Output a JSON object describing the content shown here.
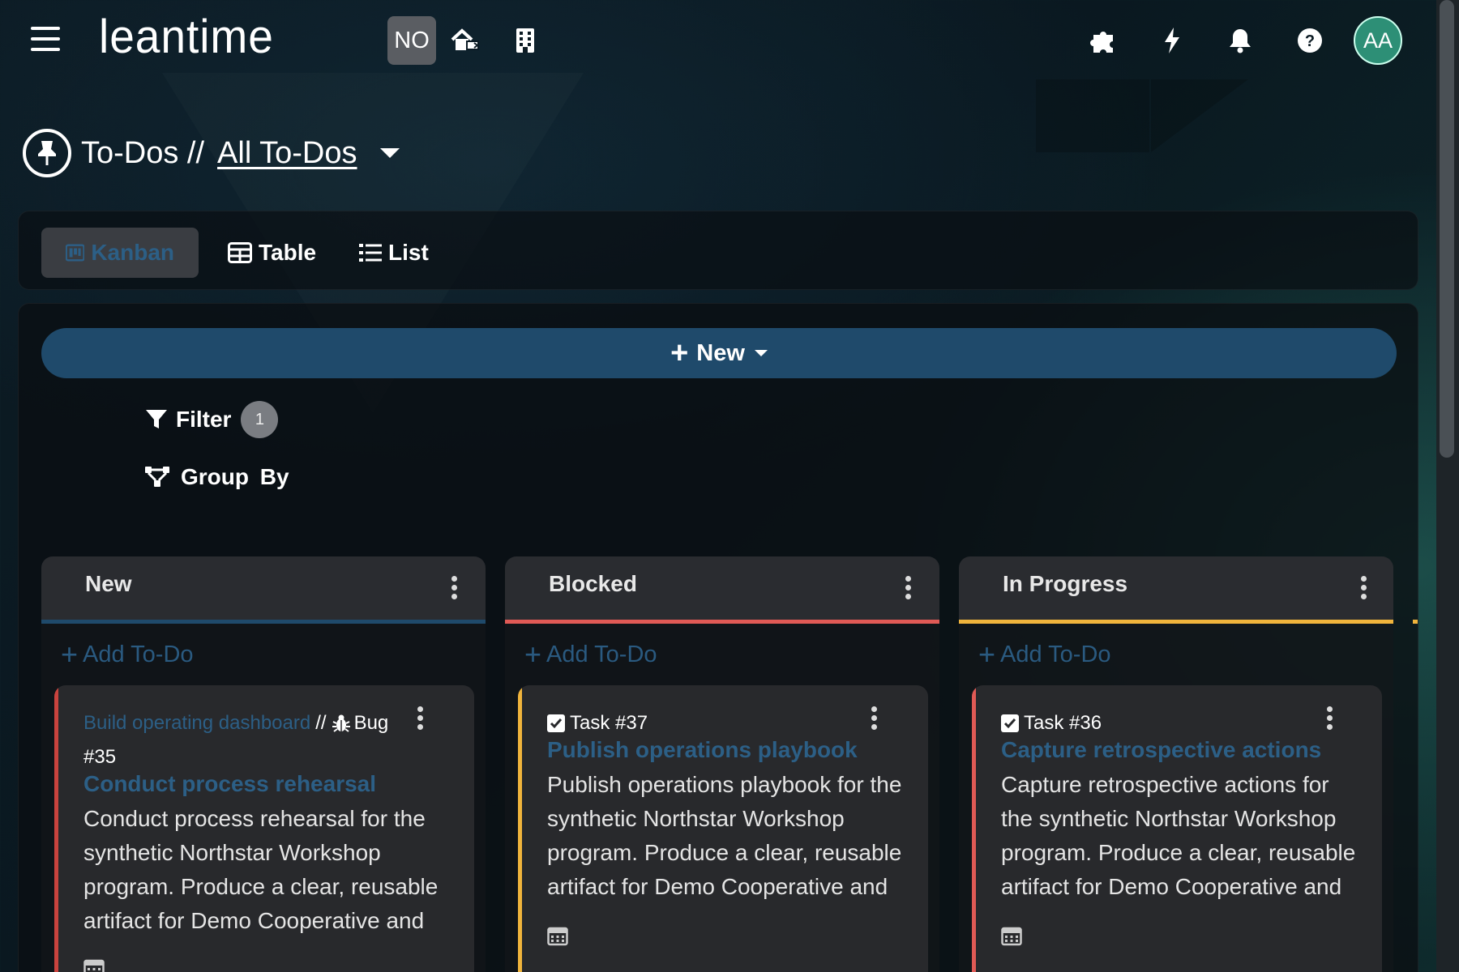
{
  "header": {
    "logo": "leantime",
    "project_badge": "NO",
    "avatar_initials": "AA",
    "icons": [
      "menu-icon",
      "home-switch-icon",
      "building-icon",
      "puzzle-icon",
      "bolt-icon",
      "bell-icon",
      "help-icon"
    ]
  },
  "page": {
    "section": "To-Dos //",
    "view_name": "All To-Dos"
  },
  "views": {
    "kanban": "Kanban",
    "table": "Table",
    "list": "List",
    "active": "Kanban"
  },
  "toolbar": {
    "new_label": "New",
    "filter_label": "Filter",
    "filter_count": "1",
    "groupby_label": "Group By"
  },
  "colors": {
    "accent": "#2c5f86",
    "new_button": "#1f4a6b",
    "status_new": "#1f4a6b",
    "status_blocked": "#e05a55",
    "status_in_progress": "#f0b43c",
    "avatar": "#2d8f76"
  },
  "columns": [
    {
      "title": "New",
      "add_label": "Add To-Do",
      "card": {
        "parent": "Build operating dashboard",
        "separator": "//",
        "type_label": "Bug",
        "number": "#35",
        "title": "Conduct process rehearsal",
        "description": "Conduct process rehearsal for the synthetic Northstar Workshop program. Produce a clear, reusable artifact for Demo Cooperative and"
      }
    },
    {
      "title": "Blocked",
      "add_label": "Add To-Do",
      "card": {
        "type_label": "Task #37",
        "title": "Publish operations playbook",
        "description": "Publish operations playbook for the synthetic Northstar Workshop program. Produce a clear, reusable artifact for Demo Cooperative and"
      }
    },
    {
      "title": "In Progress",
      "add_label": "Add To-Do",
      "card": {
        "type_label": "Task #36",
        "title": "Capture retrospective actions",
        "description": "Capture retrospective actions for the synthetic Northstar Workshop program. Produce a clear, reusable artifact for Demo Cooperative and"
      }
    }
  ]
}
